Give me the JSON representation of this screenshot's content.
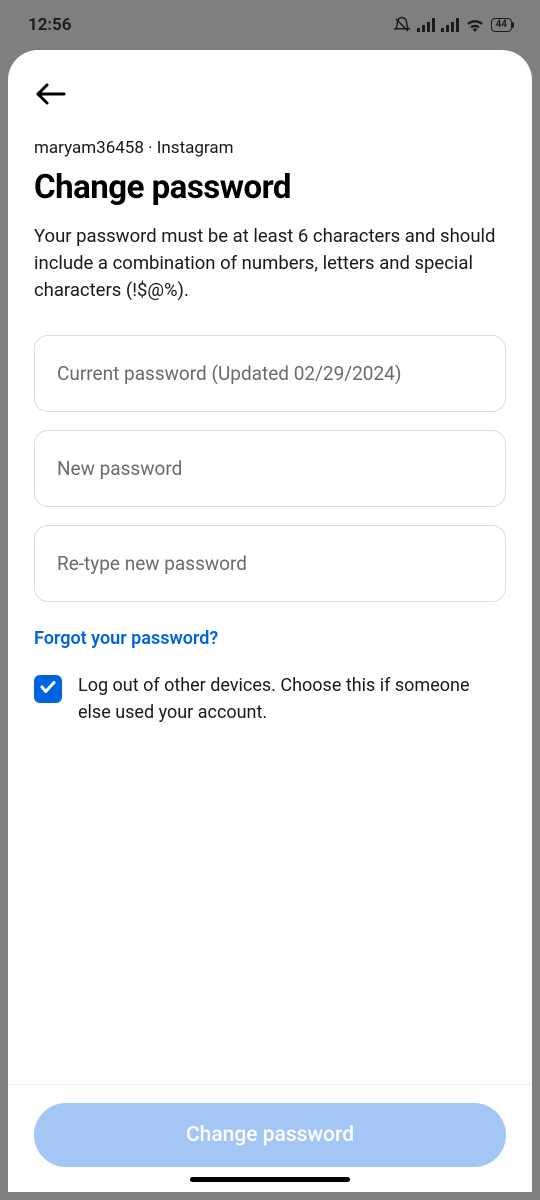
{
  "status": {
    "time": "12:56",
    "battery": "44"
  },
  "breadcrumb": "maryam36458 · Instagram",
  "title": "Change password",
  "description": "Your password must be at least 6 characters and should include a combination of numbers, letters and special characters (!$@%).",
  "fields": {
    "current_placeholder": "Current password (Updated 02/29/2024)",
    "new_placeholder": "New password",
    "retype_placeholder": "Re-type new password"
  },
  "forgot_link": "Forgot your password?",
  "logout_checkbox": {
    "checked": true,
    "label": "Log out of other devices. Choose this if someone else used your account."
  },
  "submit_label": "Change password",
  "colors": {
    "accent": "#0064e0",
    "submit_bg": "#a3c6f5"
  }
}
